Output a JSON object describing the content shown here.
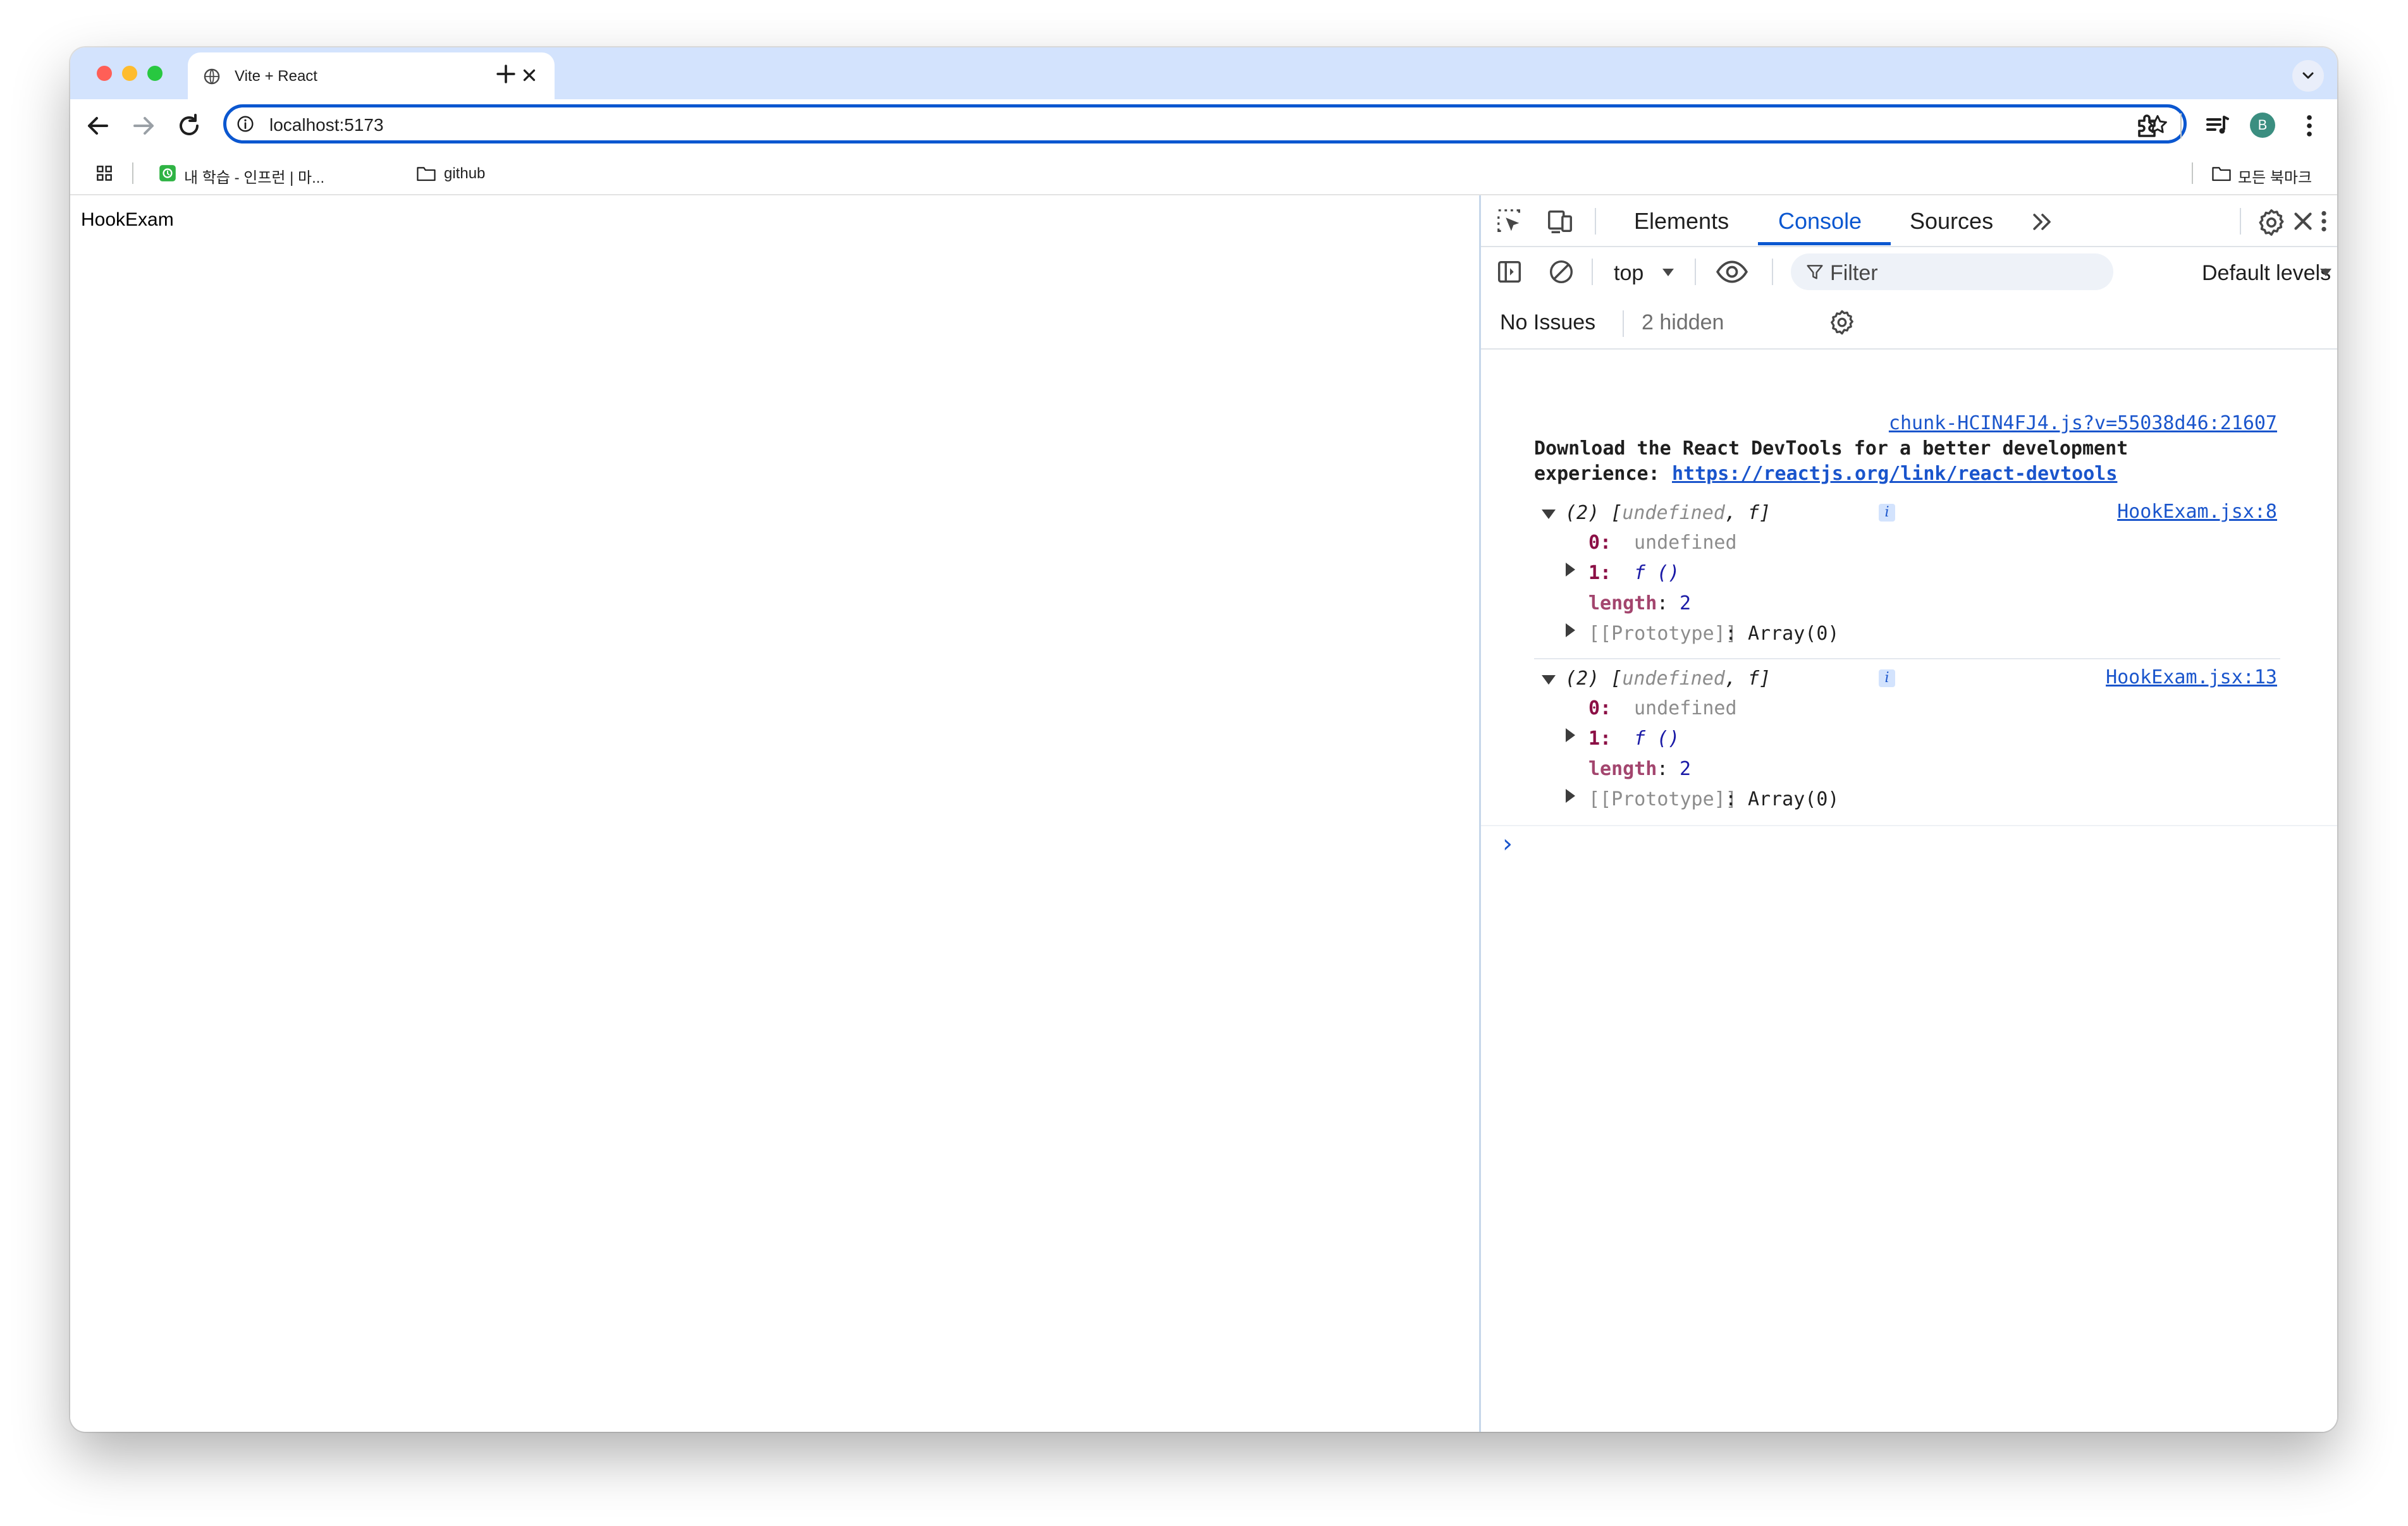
{
  "browser": {
    "tab": {
      "title": "Vite + React",
      "favicon": "globe-icon"
    },
    "address_bar": {
      "url": "localhost:5173"
    },
    "profile_initial": "B",
    "bookmarks": [
      {
        "label": "내 학습 - 인프런 | 마...",
        "icon": "inflearn-icon"
      },
      {
        "label": "github",
        "icon": "folder-icon"
      }
    ],
    "all_bookmarks_label": "모든 북마크",
    "colors": {
      "tab_strip": "#d3e3fd",
      "accent": "#0b57d0"
    }
  },
  "page": {
    "heading": "HookExam"
  },
  "devtools": {
    "tabs": [
      {
        "label": "Elements"
      },
      {
        "label": "Console",
        "selected": true
      },
      {
        "label": "Sources"
      }
    ],
    "context": "top",
    "filter_placeholder": "Filter",
    "levels": "Default levels",
    "issues": {
      "label": "No Issues",
      "hidden": "2 hidden"
    }
  },
  "console": {
    "devtools_message": {
      "source": "chunk-HCIN4FJ4.js?v=55038d46:21607",
      "line1": "Download the React DevTools for a better development",
      "prefix": "experience: ",
      "link": "https://reactjs.org/link/react-devtools"
    },
    "logs": [
      {
        "source": "HookExam.jsx:8",
        "summary_count": "(2)",
        "summary_open": "[",
        "summary_undefined": "undefined",
        "summary_sep": ", ",
        "summary_f": "f",
        "summary_close": "]",
        "info": "i",
        "k0": "0:",
        "v0": "undefined",
        "k1": "1:",
        "v1": "f ()",
        "klen": "length",
        "vlen": "2",
        "proto_key": "[[Prototype]]",
        "proto_val": "Array(0)"
      },
      {
        "source": "HookExam.jsx:13",
        "summary_count": "(2)",
        "summary_open": "[",
        "summary_undefined": "undefined",
        "summary_sep": ", ",
        "summary_f": "f",
        "summary_close": "]",
        "info": "i",
        "k0": "0:",
        "v0": "undefined",
        "k1": "1:",
        "v1": "f ()",
        "klen": "length",
        "vlen": "2",
        "proto_key": "[[Prototype]]",
        "proto_val": "Array(0)"
      }
    ],
    "prompt": "›"
  }
}
